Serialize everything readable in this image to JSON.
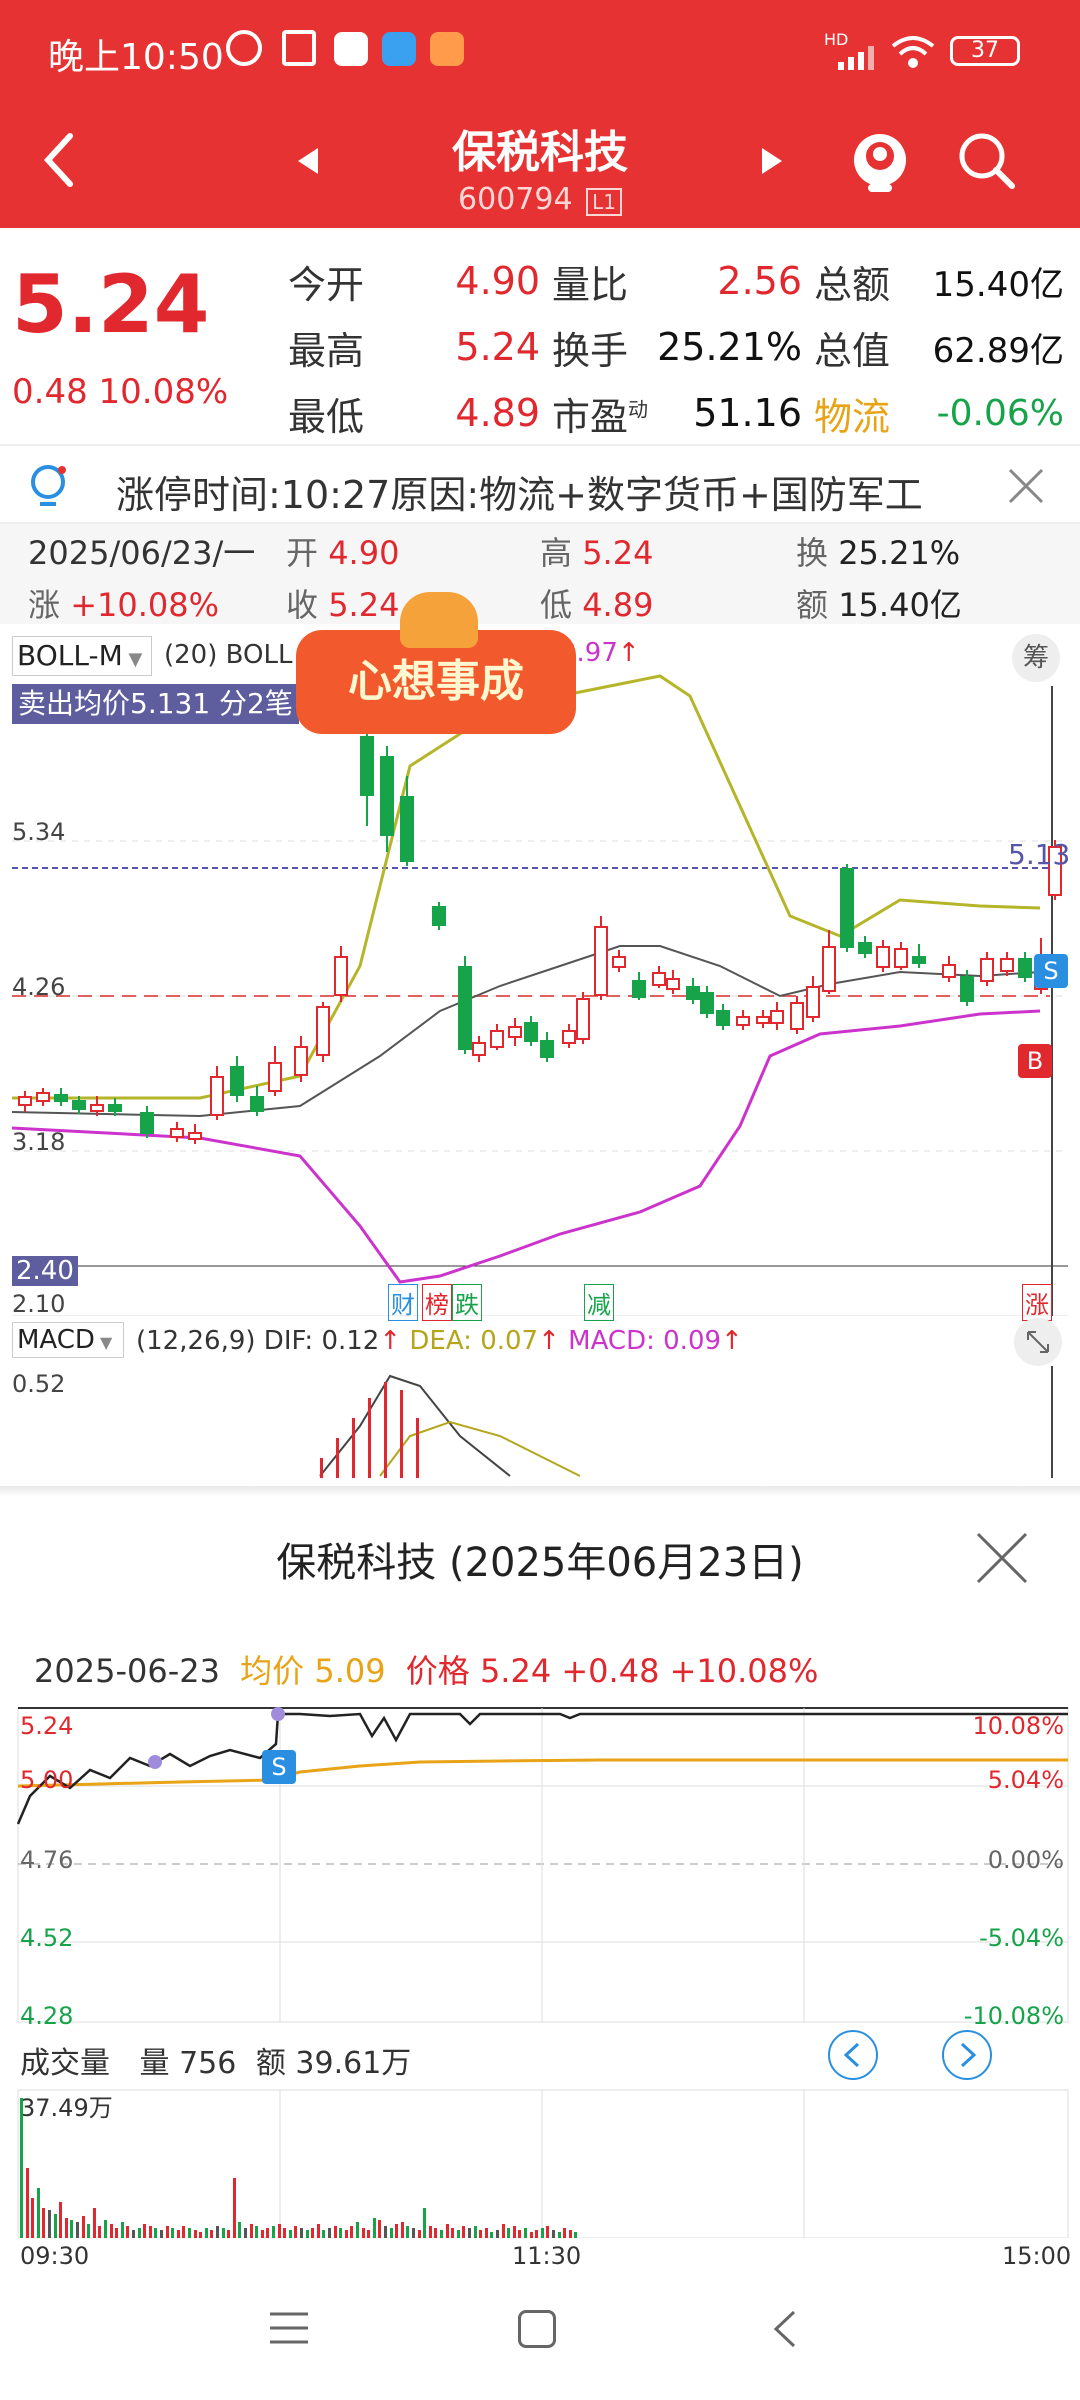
{
  "status_bar": {
    "time": "晚上10:50",
    "battery": "37",
    "hd": "HD"
  },
  "header": {
    "title": "保税科技",
    "code": "600794",
    "level_badge": "L1"
  },
  "quote": {
    "price": "5.24",
    "change": "0.48",
    "change_pct": "10.08%",
    "fields": [
      {
        "label": "今开",
        "value": "4.90",
        "color": "red"
      },
      {
        "label": "最高",
        "value": "5.24",
        "color": "red"
      },
      {
        "label": "最低",
        "value": "4.89",
        "color": "red"
      }
    ],
    "fields2": [
      {
        "label": "量比",
        "value": "2.56",
        "color": "red"
      },
      {
        "label": "换手",
        "value": "25.21%",
        "color": "black"
      },
      {
        "label": "市盈",
        "sup": "动",
        "value": "51.16",
        "color": "black"
      }
    ],
    "fields3": [
      {
        "label": "总额",
        "value": "15.40亿",
        "color": "black"
      },
      {
        "label": "总值",
        "value": "62.89亿",
        "color": "black"
      },
      {
        "label": "物流",
        "value": "-0.06%",
        "color": "green",
        "label_color": "orange"
      }
    ]
  },
  "notice": {
    "text": "涨停时间:10:27原因:物流+数字货币+国防军工"
  },
  "kline_info": {
    "date": "2025/06/23/一",
    "open_label": "开",
    "open": "4.90",
    "high_label": "高",
    "high": "5.24",
    "turnover_label": "换",
    "turnover": "25.21%",
    "change_label": "涨",
    "change": "+10.08%",
    "close_label": "收",
    "close": "5.24",
    "low_label": "低",
    "low": "4.89",
    "amount_label": "额",
    "amount": "15.40亿"
  },
  "kline_chart": {
    "indicator": "BOLL-M",
    "params": "(20) BOLL",
    "boll_upper_tail": "3.97",
    "sell_note": "卖出均价5.131 分2笔",
    "badge_text": "心想事成",
    "chip_button": "筹",
    "y_labels": [
      "5.34",
      "4.26",
      "3.18",
      "2.10"
    ],
    "current_label": "5.13",
    "low_marker": "2.40",
    "event_tags": [
      "财",
      "榜",
      "跌",
      "减",
      "涨"
    ],
    "marker_s": "S",
    "marker_b": "B"
  },
  "macd": {
    "name": "MACD",
    "params": "(12,26,9)",
    "dif": "DIF: 0.12",
    "dea": "DEA: 0.07",
    "macd": "MACD: 0.09",
    "y_label": "0.52"
  },
  "intraday": {
    "title": "保税科技 (2025年06月23日)",
    "date": "2025-06-23",
    "avg_label": "均价",
    "avg": "5.09",
    "price_label": "价格",
    "price": "5.24",
    "change": "+0.48",
    "change_pct": "+10.08%",
    "left_labels": [
      "5.24",
      "5.00",
      "4.76",
      "4.52",
      "4.28"
    ],
    "right_labels": [
      "10.08%",
      "5.04%",
      "0.00%",
      "-5.04%",
      "-10.08%"
    ],
    "marker_s": "S",
    "volume_title": "成交量",
    "volume": "量 756",
    "amount": "额 39.61万",
    "volume_max": "37.49万",
    "time_labels": [
      "09:30",
      "11:30",
      "15:00"
    ]
  },
  "colors": {
    "header_red": "#e63232",
    "up_red": "#e0282e",
    "down_green": "#16a34a",
    "boll_upper": "#b5b52a",
    "boll_lower": "#cc33cc",
    "avg_orange": "#e8a317"
  }
}
